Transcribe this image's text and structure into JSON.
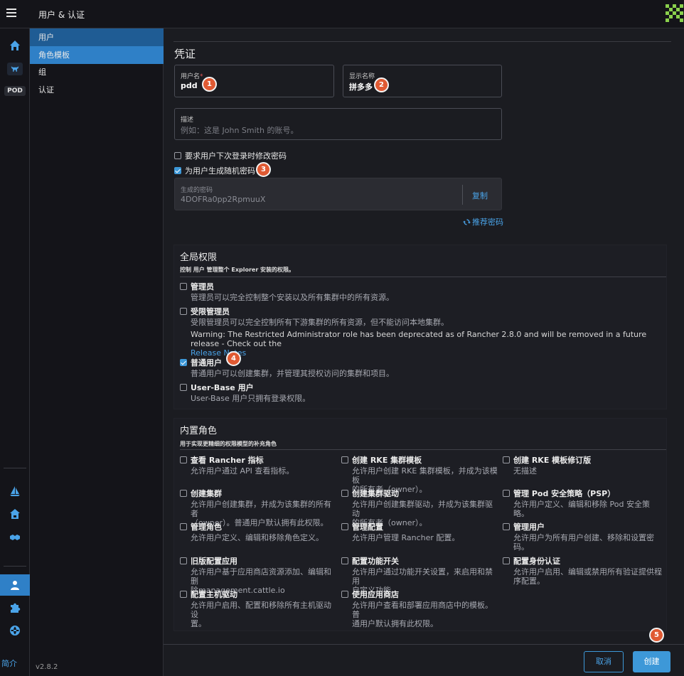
{
  "header": {
    "title": "用户 & 认证"
  },
  "rail": {
    "pod_label": "POD",
    "bottom_label": "简介"
  },
  "subnav": {
    "items": [
      {
        "label": "用户"
      },
      {
        "label": "角色模板"
      },
      {
        "label": "组"
      },
      {
        "label": "认证"
      }
    ],
    "version": "v2.8.2"
  },
  "form": {
    "section_title": "凭证",
    "username": {
      "label": "用户名",
      "required_mark": "*",
      "value": "pdd"
    },
    "display_name": {
      "label": "显示名称",
      "value": "拼多多"
    },
    "description": {
      "label": "描述",
      "placeholder": "例如：这是 John Smith 的账号。"
    },
    "require_change": {
      "label": "要求用户下次登录时修改密码",
      "checked": false
    },
    "generate_random": {
      "label": "为用户生成随机密码",
      "checked": true
    },
    "generated_password": {
      "label": "生成的密码",
      "value": "4DOFRa0pp2RpmuuX",
      "copy_label": "复制"
    },
    "regenerate_label": "推荐密码"
  },
  "markers": [
    "1",
    "2",
    "3",
    "4",
    "5"
  ],
  "global_perms": {
    "title": "全局权限",
    "subtitle": "控制 用户 管理整个 Explorer 安装的权限。",
    "options": [
      {
        "name": "管理员",
        "desc": "管理员可以完全控制整个安装以及所有集群中的所有资源。",
        "checked": false
      },
      {
        "name": "受限管理员",
        "desc": "受限管理员可以完全控制所有下游集群的所有资源，但不能访问本地集群。",
        "warning": "Warning: The Restricted Administrator role has been deprecated as of Rancher 2.8.0 and will be removed in a future release - Check out the",
        "link": "Release Notes",
        "checked": false
      },
      {
        "name": "普通用户",
        "desc": "普通用户可以创建集群，并管理其授权访问的集群和项目。",
        "checked": true
      },
      {
        "name": "User-Base 用户",
        "desc": "User-Base 用户只拥有登录权限。",
        "checked": false
      }
    ]
  },
  "builtin_roles": {
    "title": "内置角色",
    "subtitle": "用于实现更精细的权限模型的补充角色",
    "options": [
      {
        "name": "查看 Rancher 指标",
        "desc": [
          "允许用户通过 API 查看指标。"
        ]
      },
      {
        "name": "创建 RKE 集群模板",
        "desc": [
          "允许用户创建 RKE 集群模板，并成为该模板",
          "的所有者（owner）。"
        ]
      },
      {
        "name": "创建 RKE 模板修订版",
        "desc": [
          "无描述"
        ]
      },
      {
        "name": "创建集群",
        "desc": [
          "允许用户创建集群，并成为该集群的所有者",
          "（owner）。普通用户默认拥有此权限。"
        ]
      },
      {
        "name": "创建集群驱动",
        "desc": [
          "允许用户创建集群驱动，并成为该集群驱动",
          "的所有者（owner）。"
        ]
      },
      {
        "name": "管理 Pod 安全策略（PSP）",
        "desc": [
          "允许用户定义、编辑和移除 Pod 安全策略。"
        ]
      },
      {
        "name": "管理角色",
        "desc": [
          "允许用户定义、编辑和移除角色定义。"
        ]
      },
      {
        "name": "管理配置",
        "desc": [
          "允许用户管理 Rancher 配置。"
        ]
      },
      {
        "name": "管理用户",
        "desc": [
          "允许用户为所有用户创建、移除和设置密",
          "码。"
        ]
      },
      {
        "name": "旧版配置应用",
        "desc": [
          "允许用户基于应用商店资源添加、编辑和删",
          "除management.cattle.io"
        ]
      },
      {
        "name": "配置功能开关",
        "desc": [
          "允许用户通过功能开关设置，来启用和禁用",
          "自定义功能。"
        ]
      },
      {
        "name": "配置身份认证",
        "desc": [
          "允许用户启用、编辑或禁用所有验证提供程",
          "序配置。"
        ]
      },
      {
        "name": "配置主机驱动",
        "desc": [
          "允许用户启用、配置和移除所有主机驱动设",
          "置。"
        ]
      },
      {
        "name": "使用应用商店",
        "desc": [
          "允许用户查看和部署应用商店中的模板。普",
          "通用户默认拥有此权限。"
        ]
      }
    ]
  },
  "footer": {
    "cancel_label": "取消",
    "create_label": "创建"
  },
  "colors": {
    "accent": "#3d98d8",
    "marker": "#e05a33",
    "active_nav": "#2f80c7"
  }
}
